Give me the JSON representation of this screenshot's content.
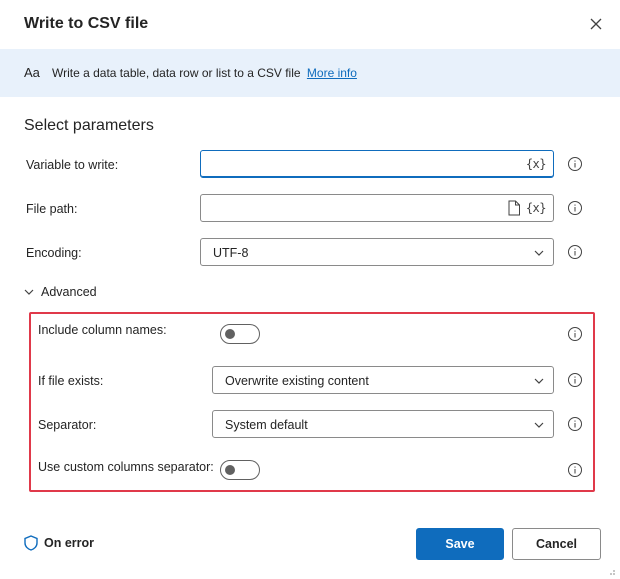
{
  "dialog": {
    "title": "Write to CSV file",
    "close_icon": "close-icon"
  },
  "banner": {
    "icon_text": "Aa",
    "description": "Write a data table, data row or list to a CSV file",
    "link": "More info"
  },
  "section": {
    "title": "Select parameters"
  },
  "params": {
    "variable_to_write": {
      "label": "Variable to write:",
      "value": "",
      "var_glyph": "{x}"
    },
    "file_path": {
      "label": "File path:",
      "value": "",
      "var_glyph": "{x}"
    },
    "encoding": {
      "label": "Encoding:",
      "value": "UTF-8"
    }
  },
  "advanced": {
    "label": "Advanced",
    "expanded": true,
    "include_column_names": {
      "label": "Include column names:",
      "on": false
    },
    "if_file_exists": {
      "label": "If file exists:",
      "value": "Overwrite existing content"
    },
    "separator": {
      "label": "Separator:",
      "value": "System default"
    },
    "use_custom_columns_separator": {
      "label": "Use custom columns separator:",
      "on": false
    }
  },
  "footer": {
    "on_error": "On error",
    "save": "Save",
    "cancel": "Cancel"
  },
  "colors": {
    "accent": "#0f6cbd",
    "banner_bg": "#e8f1fb",
    "highlight_border": "#e0394a"
  }
}
